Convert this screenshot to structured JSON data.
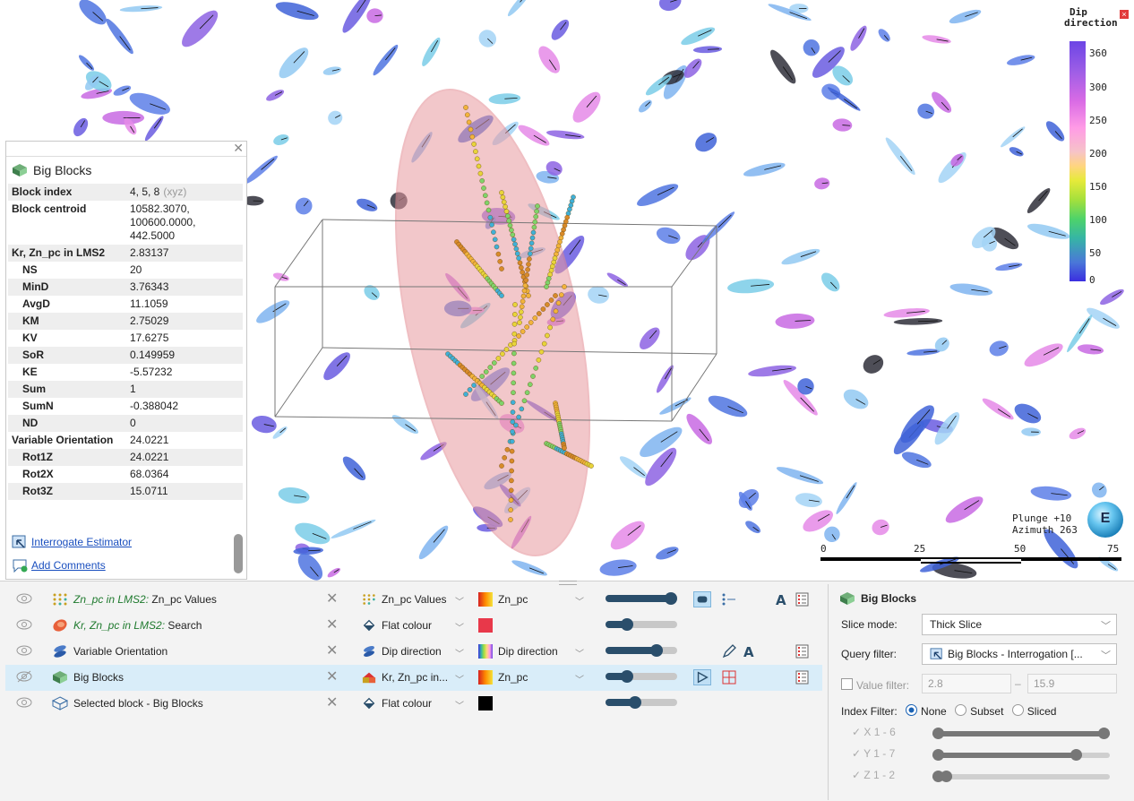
{
  "legend": {
    "title_line1": "Dip",
    "title_line2": "direction",
    "close": "×",
    "ticks": [
      "360",
      "300",
      "250",
      "200",
      "150",
      "100",
      "50",
      "0"
    ]
  },
  "orientation": {
    "plunge": "Plunge +10",
    "azimuth": "Azimuth 263",
    "globe_letter": "E"
  },
  "scale_bar": {
    "labels": [
      "0",
      "25",
      "50",
      "75"
    ]
  },
  "info_panel": {
    "title": "Big Blocks",
    "rows": [
      {
        "key": "Block index",
        "value": "4, 5, 8",
        "suffix": "(xyz)",
        "indent": false
      },
      {
        "key": "Block centroid",
        "value": "10582.3070,\n100600.0000,\n442.5000",
        "indent": false
      },
      {
        "key": "Kr, Zn_pc in LMS2",
        "value": "2.83137",
        "indent": false
      },
      {
        "key": "NS",
        "value": "20",
        "indent": true
      },
      {
        "key": "MinD",
        "value": "3.76343",
        "indent": true
      },
      {
        "key": "AvgD",
        "value": "11.1059",
        "indent": true
      },
      {
        "key": "KM",
        "value": "2.75029",
        "indent": true
      },
      {
        "key": "KV",
        "value": "17.6275",
        "indent": true
      },
      {
        "key": "SoR",
        "value": "0.149959",
        "indent": true
      },
      {
        "key": "KE",
        "value": "-5.57232",
        "indent": true
      },
      {
        "key": "Sum",
        "value": "1",
        "indent": true
      },
      {
        "key": "SumN",
        "value": "-0.388042",
        "indent": true
      },
      {
        "key": "ND",
        "value": "0",
        "indent": true
      },
      {
        "key": "Variable Orientation",
        "value": "24.0221",
        "indent": false
      },
      {
        "key": "Rot1Z",
        "value": "24.0221",
        "indent": true
      },
      {
        "key": "Rot2X",
        "value": "68.0364",
        "indent": true
      },
      {
        "key": "Rot3Z",
        "value": "15.0711",
        "indent": true
      }
    ],
    "links": {
      "interrogate": "Interrogate Estimator",
      "comments": "Add Comments"
    }
  },
  "layers": [
    {
      "name_italic": "Zn_pc in LMS2:",
      "name": " Zn_pc Values",
      "colour_by": "Zn_pc Values",
      "scheme": "Zn_pc",
      "opacity": 1.0,
      "visible": true
    },
    {
      "name_italic": "Kr, Zn_pc in LMS2:",
      "name": " Search",
      "colour_by": "Flat colour",
      "scheme": "",
      "flat_colour": "#e8384a",
      "opacity": 0.25,
      "visible": true
    },
    {
      "name_italic": "",
      "name": "Variable Orientation",
      "colour_by": "Dip direction",
      "scheme": "Dip direction",
      "opacity": 0.75,
      "visible": true
    },
    {
      "name_italic": "",
      "name": "Big Blocks",
      "colour_by": "Kr, Zn_pc in...",
      "scheme": "Zn_pc",
      "opacity": 0.25,
      "visible": false,
      "selected": true
    },
    {
      "name_italic": "",
      "name": "Selected block - Big Blocks",
      "colour_by": "Flat colour",
      "scheme": "",
      "flat_colour": "#000000",
      "opacity": 0.4,
      "visible": true
    }
  ],
  "properties": {
    "title": "Big Blocks",
    "slice_mode_label": "Slice mode:",
    "slice_mode_value": "Thick Slice",
    "query_filter_label": "Query filter:",
    "query_filter_value": "Big Blocks - Interrogation [...",
    "value_filter_label": "Value filter:",
    "value_min": "2.8",
    "value_max": "15.9",
    "dash": "–",
    "index_filter_label": "Index Filter:",
    "index_options": [
      "None",
      "Subset",
      "Sliced"
    ],
    "index_selected": "None",
    "index_ranges": [
      {
        "axis": "X 1 - 6",
        "low": 0.0,
        "high": 1.0
      },
      {
        "axis": "Y 1 - 7",
        "low": 0.0,
        "high": 0.83
      },
      {
        "axis": "Z 1 - 2",
        "low": 0.0,
        "high": 0.05
      }
    ]
  }
}
